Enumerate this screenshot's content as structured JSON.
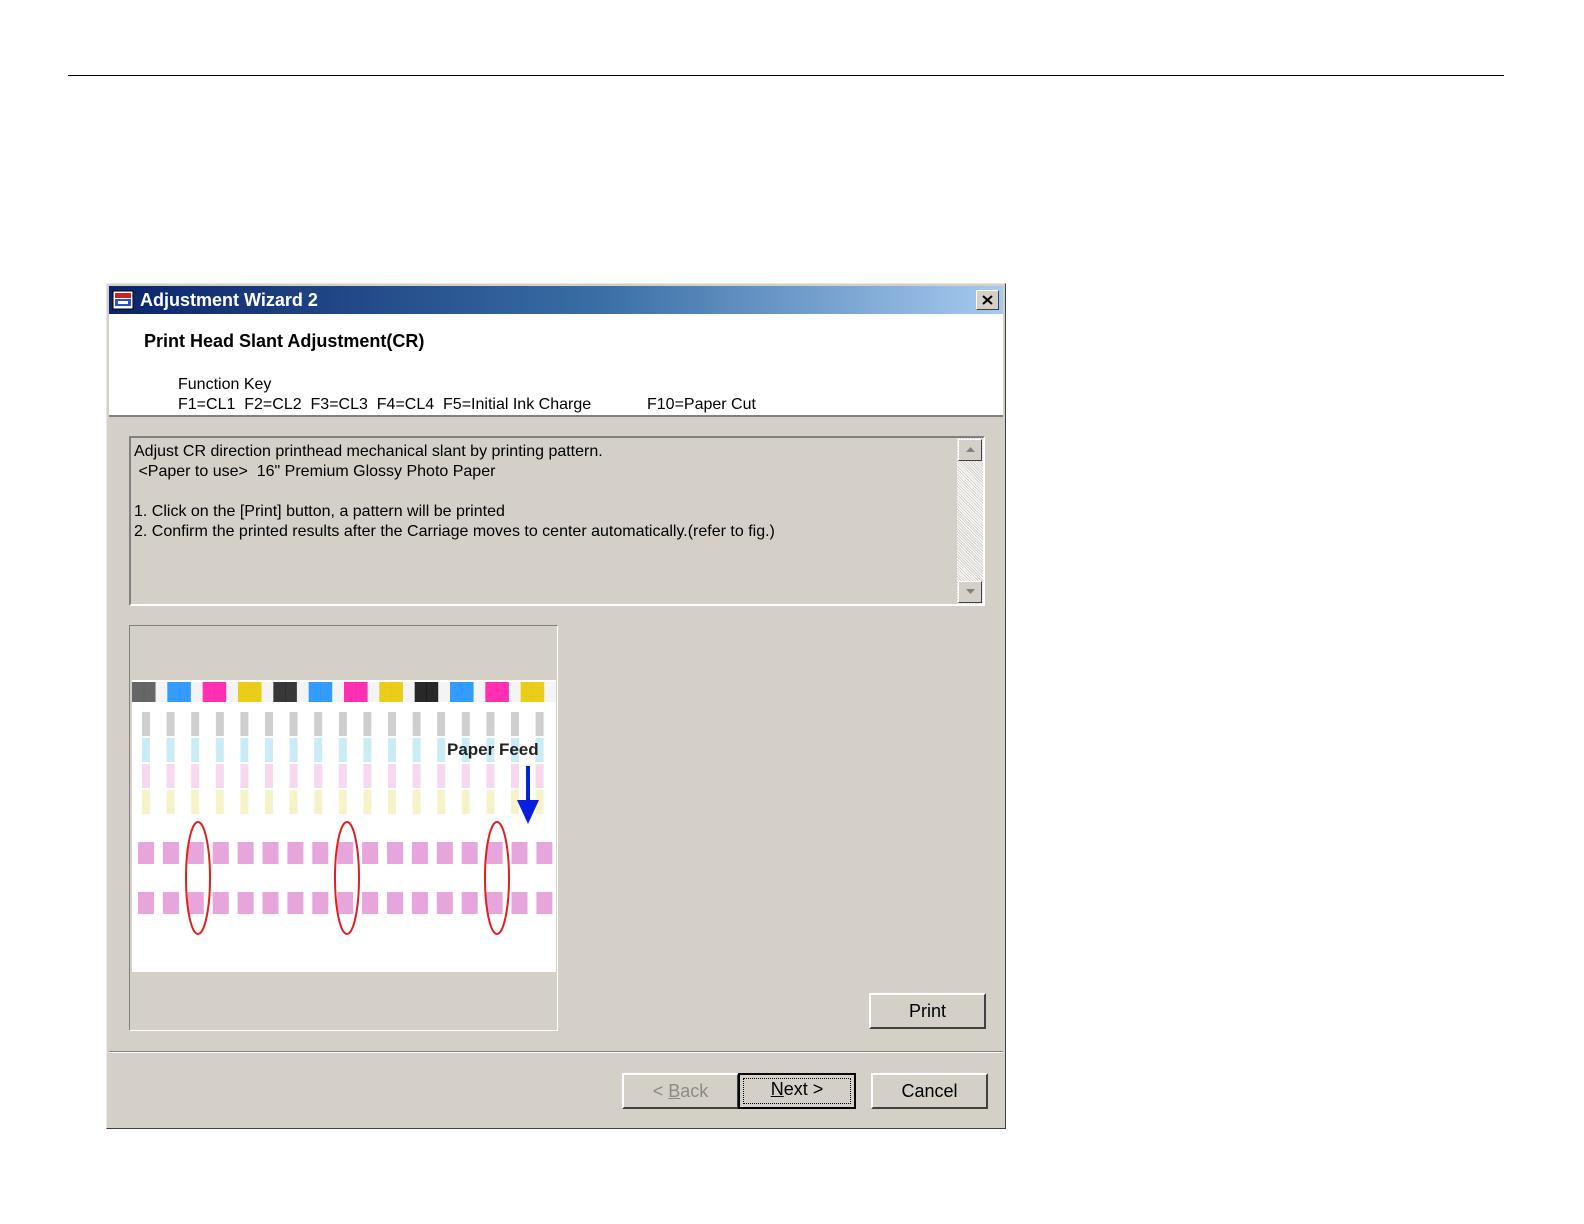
{
  "window": {
    "title": "Adjustment Wizard 2"
  },
  "header": {
    "title": "Print Head Slant Adjustment(CR)",
    "function_key_label": "Function Key",
    "function_keys": "F1=CL1  F2=CL2  F3=CL3  F4=CL4  F5=Initial Ink Charge",
    "function_key_extra": "F10=Paper Cut"
  },
  "description": {
    "lines": [
      "Adjust CR direction printhead mechanical slant by printing pattern.",
      " <Paper to use>  16\" Premium Glossy Photo Paper",
      "",
      "1. Click on the [Print] button, a pattern will be printed",
      "2. Confirm the printed results after the Carriage moves to center automatically.(refer to fig.)"
    ]
  },
  "figure": {
    "annotation": "Paper Feed",
    "color_sequence": [
      "#555555",
      "#1e90ff",
      "#ff1aa8",
      "#e8c800",
      "#222222",
      "#1e90ff",
      "#ff1aa8",
      "#e8c800",
      "#111111",
      "#1e90ff",
      "#ff1aa8",
      "#e8c800"
    ],
    "highlight_color": "#e02020",
    "arrow_color": "#0a1ee0"
  },
  "buttons": {
    "print": "Print",
    "back_prefix": "< ",
    "back_key": "B",
    "back_rest": "ack",
    "next_key": "N",
    "next_rest": "ext >",
    "cancel": "Cancel"
  }
}
